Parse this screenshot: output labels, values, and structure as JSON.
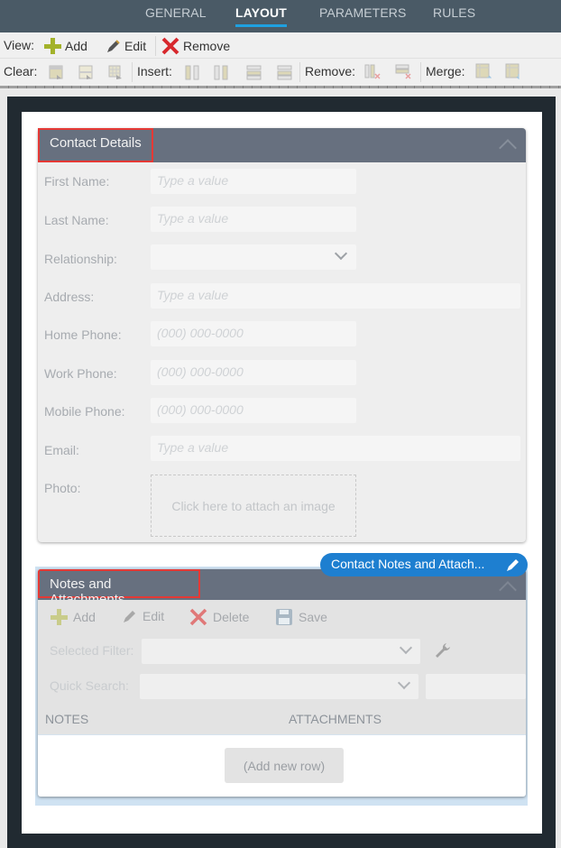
{
  "tabs": [
    {
      "label": "GENERAL",
      "active": false
    },
    {
      "label": "LAYOUT",
      "active": true
    },
    {
      "label": "PARAMETERS",
      "active": false
    },
    {
      "label": "RULES",
      "active": false
    }
  ],
  "toolbar_view": {
    "label": "View:",
    "add": "Add",
    "edit": "Edit",
    "remove": "Remove"
  },
  "toolbar_layout": {
    "clear_label": "Clear:",
    "insert_label": "Insert:",
    "remove_label": "Remove:",
    "merge_label": "Merge:",
    "clear_icons": [
      "clear-cell-icon",
      "clear-cell-format-icon",
      "clear-table-icon"
    ],
    "insert_icons": [
      "insert-column-left-icon",
      "insert-column-right-icon",
      "insert-row-above-icon",
      "insert-row-below-icon"
    ],
    "remove_icons": [
      "remove-column-icon",
      "remove-row-icon"
    ],
    "merge_icons": [
      "merge-right-icon",
      "merge-down-icon"
    ]
  },
  "contact_details": {
    "title": "Contact Details",
    "fields": [
      {
        "label": "First Name:",
        "placeholder": "Type a value",
        "type": "text"
      },
      {
        "label": "Last Name:",
        "placeholder": "Type a value",
        "type": "text"
      },
      {
        "label": "Relationship:",
        "placeholder": "",
        "type": "dropdown"
      },
      {
        "label": "Address:",
        "placeholder": "Type a value",
        "type": "text"
      },
      {
        "label": "Home Phone:",
        "placeholder": "(000) 000-0000",
        "type": "text"
      },
      {
        "label": "Work Phone:",
        "placeholder": "(000) 000-0000",
        "type": "text"
      },
      {
        "label": "Mobile Phone:",
        "placeholder": "(000) 000-0000",
        "type": "text"
      },
      {
        "label": "Email:",
        "placeholder": "Type a value",
        "type": "text"
      }
    ],
    "photo_label": "Photo:",
    "photo_prompt": "Click here to attach an image"
  },
  "selected_control": {
    "label": "Contact Notes and Attach..."
  },
  "notes": {
    "title": "Notes and Attachments",
    "actions": {
      "add": "Add",
      "edit": "Edit",
      "delete": "Delete",
      "save": "Save"
    },
    "selected_filter_label": "Selected Filter:",
    "quick_search_label": "Quick Search:",
    "columns": [
      "NOTES",
      "ATTACHMENTS"
    ],
    "add_row": "(Add new row)"
  },
  "colors": {
    "tab_bar": "#4a5a66",
    "tab_underline": "#1ea0e0",
    "panel_header": "#67707f",
    "highlight_border": "#e53935",
    "selected_pill": "#1e7fd0",
    "canvas": "#212a31"
  }
}
